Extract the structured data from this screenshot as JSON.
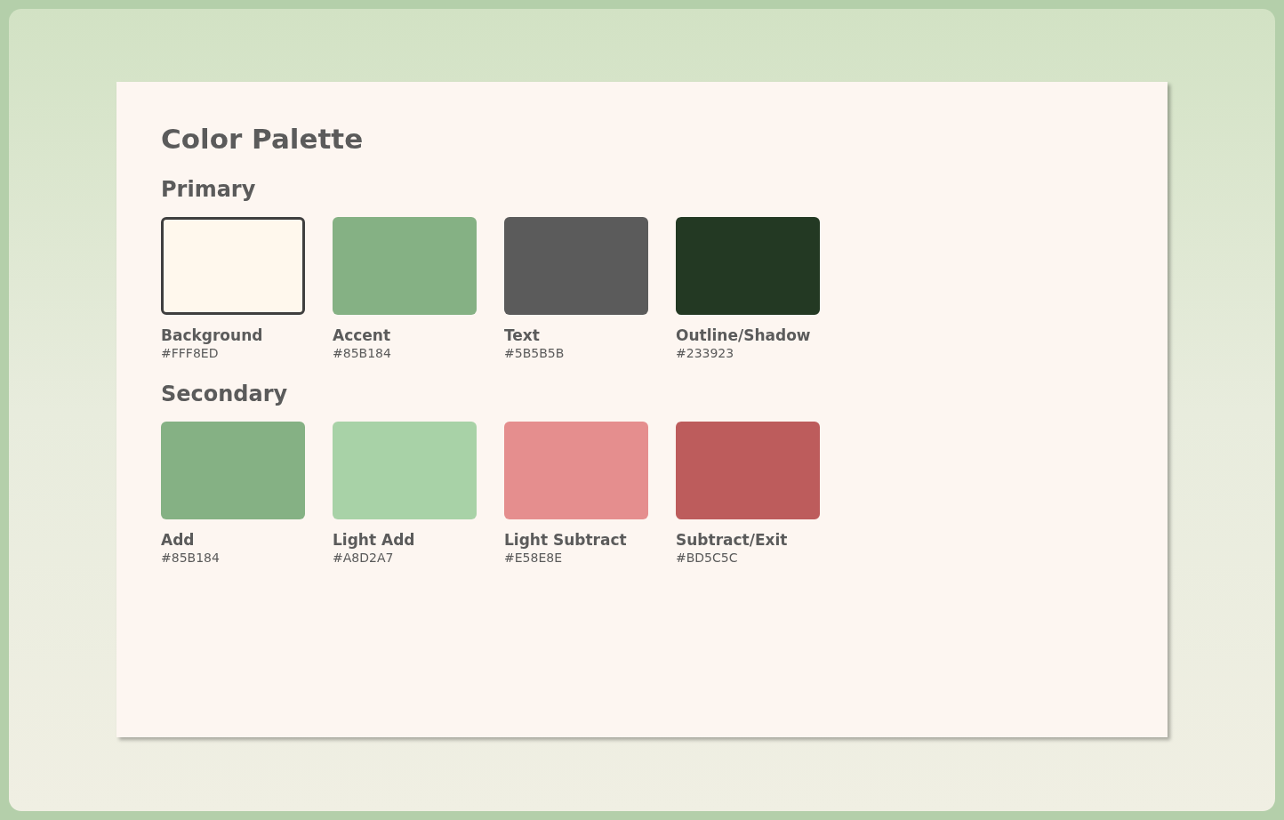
{
  "title": "Color Palette",
  "groups": [
    {
      "heading": "Primary",
      "swatches": [
        {
          "name": "Background",
          "hex": "#FFF8ED",
          "color": "#fff8ed",
          "outlined": true
        },
        {
          "name": "Accent",
          "hex": "#85B184",
          "color": "#85b184",
          "outlined": false
        },
        {
          "name": "Text",
          "hex": "#5B5B5B",
          "color": "#5b5b5b",
          "outlined": false
        },
        {
          "name": "Outline/Shadow",
          "hex": "#233923",
          "color": "#233923",
          "outlined": false
        }
      ]
    },
    {
      "heading": "Secondary",
      "swatches": [
        {
          "name": "Add",
          "hex": "#85B184",
          "color": "#85b184",
          "outlined": false
        },
        {
          "name": "Light Add",
          "hex": "#A8D2A7",
          "color": "#a8d2a7",
          "outlined": false
        },
        {
          "name": "Light Subtract",
          "hex": "#E58E8E",
          "color": "#e58e8e",
          "outlined": false
        },
        {
          "name": "Subtract/Exit",
          "hex": "#BD5C5C",
          "color": "#bd5c5c",
          "outlined": false
        }
      ]
    }
  ]
}
